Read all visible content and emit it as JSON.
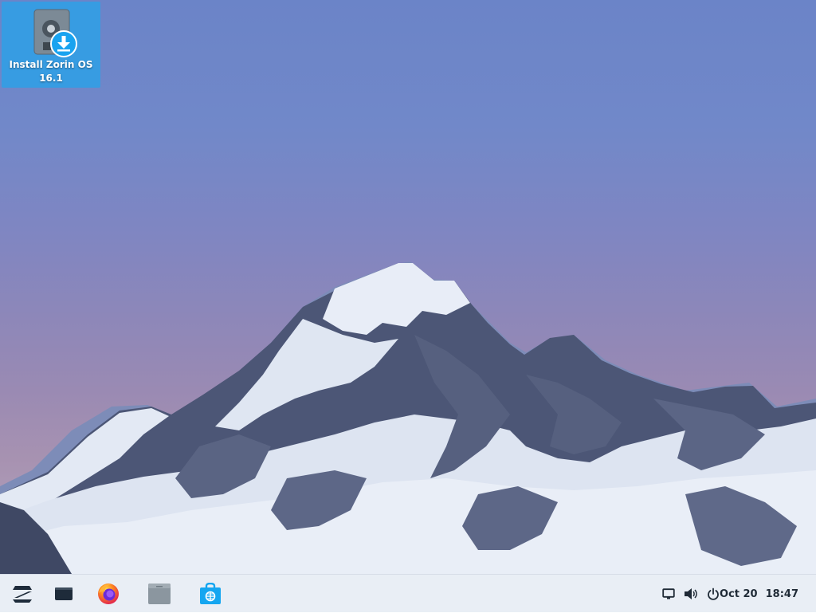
{
  "desktop": {
    "icons": [
      {
        "label": "Install Zorin OS\n16.1",
        "icon": "installer-disk-download-icon"
      }
    ]
  },
  "taskbar": {
    "launchers": [
      {
        "name": "zorin-menu",
        "icon": "zorin-logo-icon"
      },
      {
        "name": "workspace-switcher",
        "icon": "window-overview-icon"
      },
      {
        "name": "firefox",
        "icon": "firefox-icon"
      },
      {
        "name": "files",
        "icon": "folder-icon"
      },
      {
        "name": "software",
        "icon": "software-store-icon"
      }
    ],
    "tray": [
      {
        "name": "screen",
        "icon": "display-icon"
      },
      {
        "name": "volume",
        "icon": "volume-icon"
      },
      {
        "name": "power",
        "icon": "power-icon"
      }
    ],
    "clock": {
      "date": "Oct 20",
      "time": "18:47"
    }
  },
  "colors": {
    "sky_top": "#6b84c8",
    "sky_bottom": "#b7a7bf",
    "taskbar_bg": "#e9eef5",
    "selection": "#2ea0e6",
    "accent_blue": "#15a6f0"
  }
}
